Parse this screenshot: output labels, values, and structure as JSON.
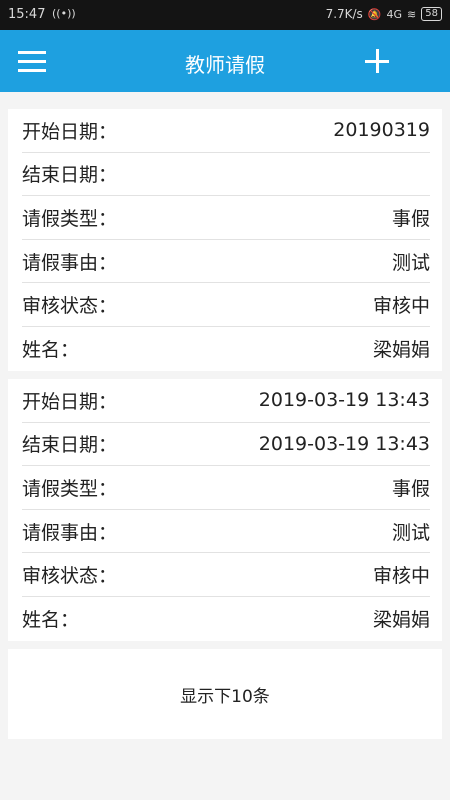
{
  "status_bar": {
    "time": "15:47",
    "radio_icon": "((•))",
    "speed": "7.7K/s",
    "mute_icon": "🔕",
    "network": "4G",
    "wifi_icon": "≋",
    "battery": "58"
  },
  "header": {
    "title": "教师请假",
    "menu_icon": "menu-icon",
    "add_icon": "plus-icon"
  },
  "records": [
    {
      "start_label": "开始日期：",
      "start_value": "20190319",
      "end_label": "结束日期：",
      "end_value": "",
      "type_label": "请假类型：",
      "type_value": "事假",
      "reason_label": "请假事由：",
      "reason_value": "测试",
      "status_label": "审核状态：",
      "status_value": "审核中",
      "name_label": "姓名：",
      "name_value": "梁娟娟"
    },
    {
      "start_label": "开始日期：",
      "start_value": "2019-03-19 13:43",
      "end_label": "结束日期：",
      "end_value": "2019-03-19 13:43",
      "type_label": "请假类型：",
      "type_value": "事假",
      "reason_label": "请假事由：",
      "reason_value": "测试",
      "status_label": "审核状态：",
      "status_value": "审核中",
      "name_label": "姓名：",
      "name_value": "梁娟娟"
    }
  ],
  "load_more": {
    "label": "显示下10条"
  },
  "colors": {
    "header_bg": "#1ea0e0",
    "page_bg": "#f4f4f4",
    "status_bg": "#141414"
  }
}
